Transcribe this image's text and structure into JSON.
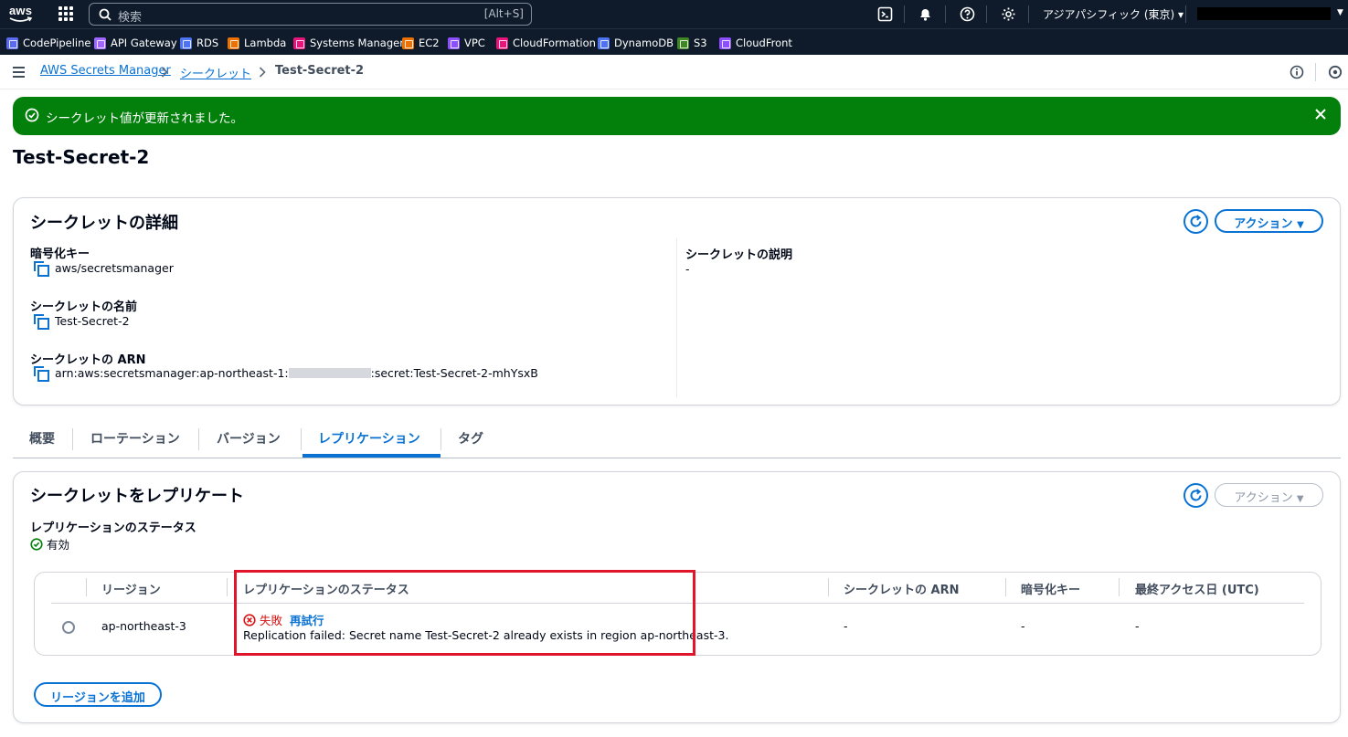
{
  "topnav": {
    "logo": "aws",
    "search_placeholder": "検索",
    "search_shortcut": "[Alt+S]",
    "region": "アジアパシフィック (東京)"
  },
  "favorites": [
    {
      "label": "CodePipeline",
      "color": "#5a6bf0"
    },
    {
      "label": "API Gateway",
      "color": "#a166ff"
    },
    {
      "label": "RDS",
      "color": "#4d72f3"
    },
    {
      "label": "Lambda",
      "color": "#ed7100"
    },
    {
      "label": "Systems Manager",
      "color": "#e7157b"
    },
    {
      "label": "EC2",
      "color": "#ed7100"
    },
    {
      "label": "VPC",
      "color": "#8c4fff"
    },
    {
      "label": "CloudFormation",
      "color": "#e7157b"
    },
    {
      "label": "DynamoDB",
      "color": "#4d72f3"
    },
    {
      "label": "S3",
      "color": "#3f8624"
    },
    {
      "label": "CloudFront",
      "color": "#8c4fff"
    }
  ],
  "breadcrumb": {
    "root": "AWS Secrets Manager",
    "section": "シークレット",
    "current": "Test-Secret-2"
  },
  "flash": {
    "message": "シークレット値が更新されました。"
  },
  "page_title": "Test-Secret-2",
  "details": {
    "heading": "シークレットの詳細",
    "actions_label": "アクション",
    "encryption_key_label": "暗号化キー",
    "encryption_key_value": "aws/secretsmanager",
    "name_label": "シークレットの名前",
    "name_value": "Test-Secret-2",
    "arn_label": "シークレットの ARN",
    "arn_prefix": "arn:aws:secretsmanager:ap-northeast-1:",
    "arn_suffix": ":secret:Test-Secret-2-mhYsxB",
    "description_label": "シークレットの説明",
    "description_value": "-"
  },
  "tabs": [
    "概要",
    "ローテーション",
    "バージョン",
    "レプリケーション",
    "タグ"
  ],
  "active_tab": "レプリケーション",
  "replication": {
    "heading": "シークレットをレプリケート",
    "actions_label": "アクション",
    "status_label": "レプリケーションのステータス",
    "status_value": "有効",
    "table": {
      "headers": [
        "リージョン",
        "レプリケーションのステータス",
        "シークレットの ARN",
        "暗号化キー",
        "最終アクセス日 (UTC)"
      ],
      "rows": [
        {
          "region": "ap-northeast-3",
          "status": "失敗",
          "retry": "再試行",
          "error": "Replication failed: Secret name Test-Secret-2 already exists in region ap-northeast-3.",
          "arn": "-",
          "key": "-",
          "last_access": "-"
        }
      ]
    },
    "add_region_label": "リージョンを追加"
  }
}
